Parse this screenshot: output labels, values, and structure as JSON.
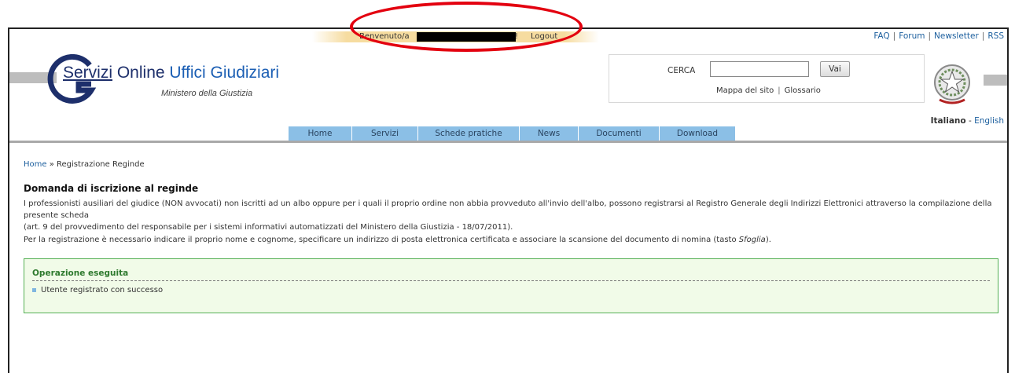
{
  "header": {
    "welcome_label": "Benvenuto/a",
    "welcome_suffix": "!",
    "logout_label": "Logout",
    "top_links": [
      "FAQ",
      "Forum",
      "Newsletter",
      "RSS"
    ]
  },
  "logo": {
    "title_part1": "Servizi",
    "title_part2": " Online ",
    "title_part3": "Uffici Giudiziari",
    "subtitle": "Ministero della Giustizia"
  },
  "search": {
    "label": "CERCA",
    "input_value": "",
    "button_label": "Vai",
    "links": [
      "Mappa del sito",
      "Glossario"
    ]
  },
  "language": {
    "current": "Italiano",
    "separator": " - ",
    "other": "English"
  },
  "nav": {
    "items": [
      "Home",
      "Servizi",
      "Schede pratiche",
      "News",
      "Documenti",
      "Download"
    ]
  },
  "breadcrumb": {
    "home": "Home",
    "separator": " » ",
    "current": "Registrazione Reginde"
  },
  "main": {
    "heading": "Domanda di iscrizione al reginde",
    "paragraph1_line1": "I professionisti ausiliari del giudice (NON avvocati) non iscritti ad un albo oppure per i quali il proprio ordine non abbia provveduto all'invio dell'albo, possono registrarsi al Registro Generale degli Indirizzi Elettronici attraverso la compilazione della presente scheda",
    "paragraph1_line2": "(art. 9 del provvedimento del responsabile per i sistemi informativi automatizzati del Ministero della Giustizia - 18/07/2011).",
    "paragraph2_text": "Per la registrazione è necessario indicare il proprio nome e cognome, specificare un indirizzo di posta elettronica certificata e associare la scansione del documento di nomina (tasto ",
    "paragraph2_italic": "Sfoglia",
    "paragraph2_end": ")."
  },
  "message": {
    "title": "Operazione eseguita",
    "item": "Utente registrato con successo"
  },
  "colors": {
    "nav_bg": "#8bbfe6",
    "success_border": "#55b055",
    "success_bg": "#f1fbe8",
    "annotation": "#e3000f"
  }
}
